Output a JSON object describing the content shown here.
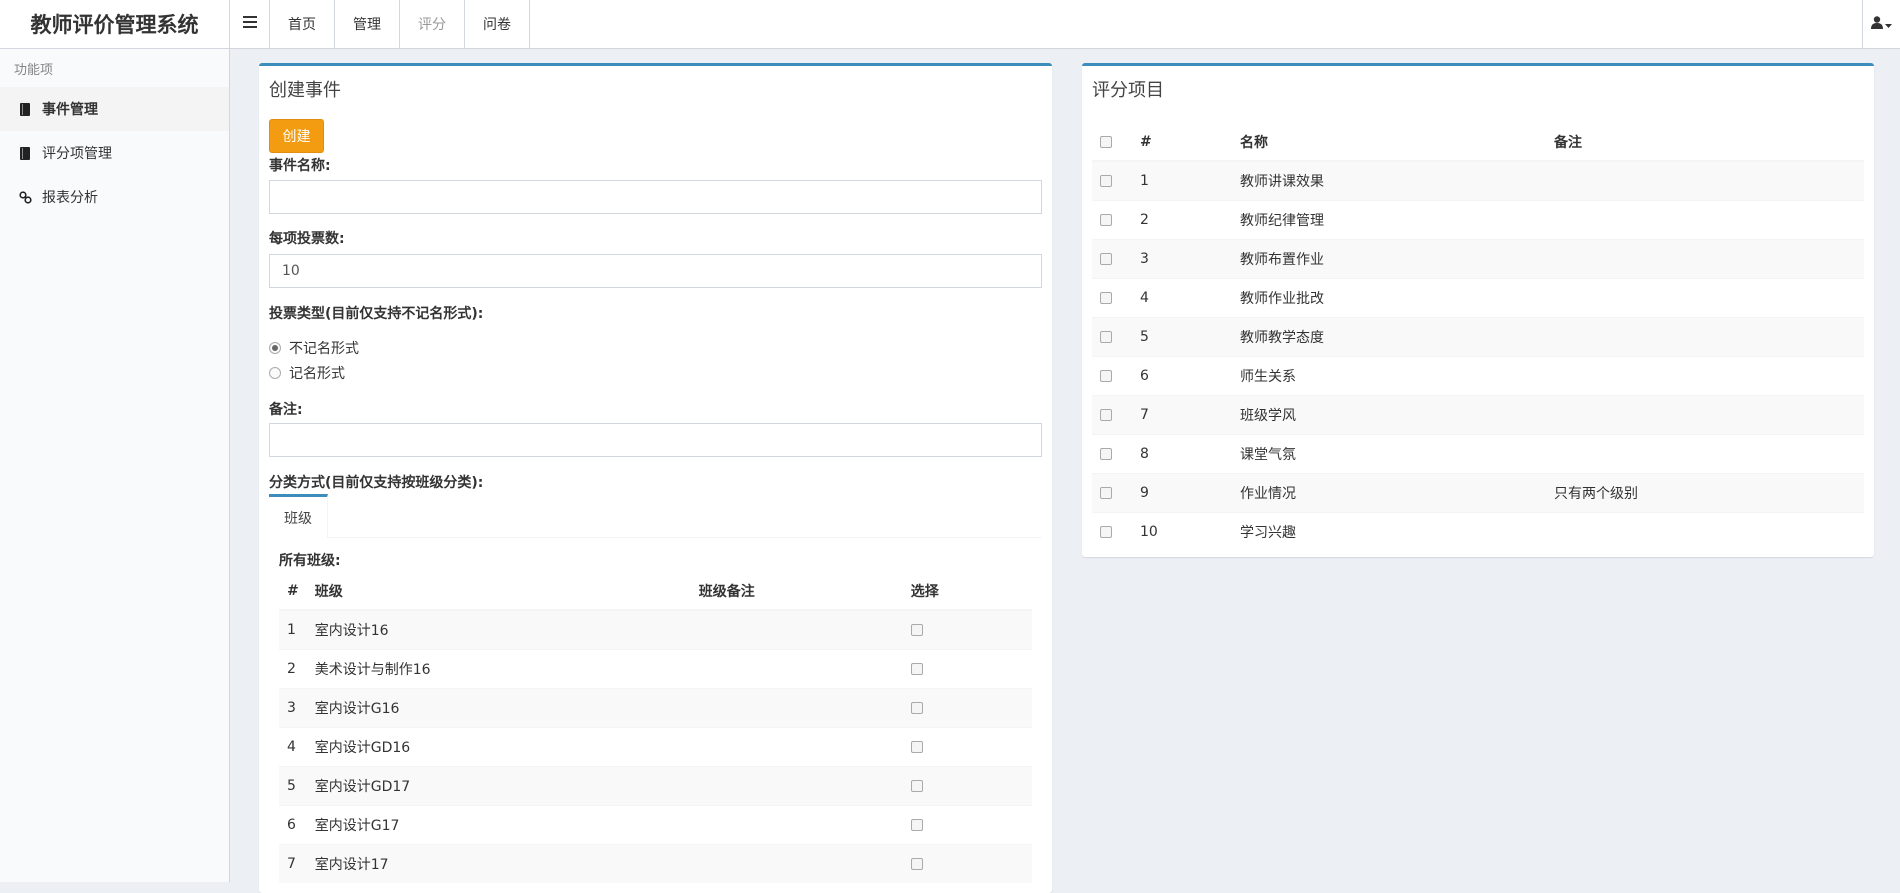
{
  "app": {
    "title": "教师评价管理系统"
  },
  "nav": {
    "items": [
      {
        "label": "首页"
      },
      {
        "label": "管理"
      },
      {
        "label": "评分"
      },
      {
        "label": "问卷"
      }
    ]
  },
  "sidebar": {
    "header": "功能项",
    "items": [
      {
        "label": "事件管理",
        "icon": "book-icon"
      },
      {
        "label": "评分项管理",
        "icon": "book-icon"
      },
      {
        "label": "报表分析",
        "icon": "link-icon"
      }
    ]
  },
  "create_event": {
    "title": "创建事件",
    "create_button": "创建",
    "name_label": "事件名称:",
    "name_value": "",
    "votes_label": "每项投票数:",
    "votes_value": "10",
    "vote_type_label": "投票类型(目前仅支持不记名形式):",
    "vote_types": [
      {
        "label": "不记名形式",
        "checked": true
      },
      {
        "label": "记名形式",
        "checked": false
      }
    ],
    "remark_label": "备注:",
    "remark_value": "",
    "category_label": "分类方式(目前仅支持按班级分类):",
    "tab_label": "班级",
    "all_classes_label": "所有班级:",
    "class_table": {
      "headers": [
        "#",
        "班级",
        "班级备注",
        "选择"
      ],
      "rows": [
        {
          "no": "1",
          "name": "室内设计16",
          "remark": ""
        },
        {
          "no": "2",
          "name": "美术设计与制作16",
          "remark": ""
        },
        {
          "no": "3",
          "name": "室内设计G16",
          "remark": ""
        },
        {
          "no": "4",
          "name": "室内设计GD16",
          "remark": ""
        },
        {
          "no": "5",
          "name": "室内设计GD17",
          "remark": ""
        },
        {
          "no": "6",
          "name": "室内设计G17",
          "remark": ""
        },
        {
          "no": "7",
          "name": "室内设计17",
          "remark": ""
        }
      ]
    }
  },
  "rating_items": {
    "title": "评分项目",
    "headers": [
      "#",
      "名称",
      "备注"
    ],
    "rows": [
      {
        "no": "1",
        "name": "教师讲课效果",
        "remark": ""
      },
      {
        "no": "2",
        "name": "教师纪律管理",
        "remark": ""
      },
      {
        "no": "3",
        "name": "教师布置作业",
        "remark": ""
      },
      {
        "no": "4",
        "name": "教师作业批改",
        "remark": ""
      },
      {
        "no": "5",
        "name": "教师教学态度",
        "remark": ""
      },
      {
        "no": "6",
        "name": "师生关系",
        "remark": ""
      },
      {
        "no": "7",
        "name": "班级学风",
        "remark": ""
      },
      {
        "no": "8",
        "name": "课堂气氛",
        "remark": ""
      },
      {
        "no": "9",
        "name": "作业情况",
        "remark": "只有两个级别"
      },
      {
        "no": "10",
        "name": "学习兴趣",
        "remark": ""
      }
    ]
  },
  "colors": {
    "accent": "#3c8dbc",
    "create_button": "#f39c12",
    "background": "#ecf0f5"
  }
}
